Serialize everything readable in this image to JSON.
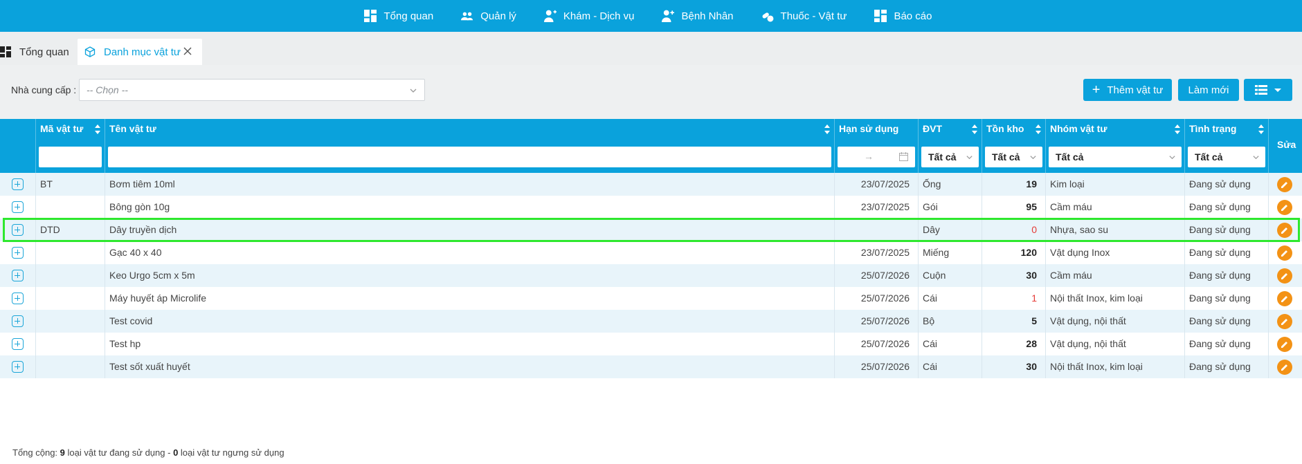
{
  "nav": {
    "items": [
      {
        "label": "Tổng quan",
        "icon": "dashboard-icon"
      },
      {
        "label": "Quản lý",
        "icon": "users-icon"
      },
      {
        "label": "Khám - Dịch vụ",
        "icon": "doctor-icon"
      },
      {
        "label": "Bệnh Nhân",
        "icon": "patient-icon"
      },
      {
        "label": "Thuốc - Vật tư",
        "icon": "pills-icon"
      },
      {
        "label": "Báo cáo",
        "icon": "report-icon"
      }
    ]
  },
  "tabs": [
    {
      "label": "Tổng quan",
      "active": false
    },
    {
      "label": "Danh mục vật tư",
      "active": true
    }
  ],
  "filter": {
    "supplier_label": "Nhà cung cấp :",
    "supplier_placeholder": "-- Chọn --",
    "add_button": "Thêm vật tư",
    "refresh_button": "Làm mới"
  },
  "table": {
    "headers": {
      "code": "Mã vật tư",
      "name": "Tên vật tư",
      "expiry": "Hạn sử dụng",
      "unit": "ĐVT",
      "stock": "Tồn kho",
      "group": "Nhóm vật tư",
      "status": "Tình trạng",
      "edit": "Sửa"
    },
    "filters": {
      "unit": "Tất cả",
      "stock": "Tất cả",
      "group": "Tất cả",
      "status": "Tất cả",
      "date_separator": "→"
    },
    "rows": [
      {
        "code": "BT",
        "name": "Bơm tiêm 10ml",
        "expiry": "23/07/2025",
        "unit": "Ống",
        "stock": "19",
        "group": "Kim loại",
        "status": "Đang sử dụng"
      },
      {
        "code": "",
        "name": "Bông gòn 10g",
        "expiry": "23/07/2025",
        "unit": "Gói",
        "stock": "95",
        "group": "Cầm máu",
        "status": "Đang sử dụng"
      },
      {
        "code": "DTD",
        "name": "Dây truyền dịch",
        "expiry": "",
        "unit": "Dây",
        "stock": "0",
        "group": "Nhựa, sao su",
        "status": "Đang sử dụng"
      },
      {
        "code": "",
        "name": "Gạc 40 x 40",
        "expiry": "23/07/2025",
        "unit": "Miếng",
        "stock": "120",
        "group": "Vật dụng Inox",
        "status": "Đang sử dụng"
      },
      {
        "code": "",
        "name": "Keo Urgo 5cm x 5m",
        "expiry": "25/07/2026",
        "unit": "Cuộn",
        "stock": "30",
        "group": "Cầm máu",
        "status": "Đang sử dụng"
      },
      {
        "code": "",
        "name": "Máy huyết áp Microlife",
        "expiry": "25/07/2026",
        "unit": "Cái",
        "stock": "1",
        "group": "Nội thất Inox, kim loại",
        "status": "Đang sử dụng"
      },
      {
        "code": "",
        "name": "Test covid",
        "expiry": "25/07/2026",
        "unit": "Bộ",
        "stock": "5",
        "group": "Vật dụng, nội thất",
        "status": "Đang sử dụng"
      },
      {
        "code": "",
        "name": "Test hp",
        "expiry": "25/07/2026",
        "unit": "Cái",
        "stock": "28",
        "group": "Vật dụng, nội thất",
        "status": "Đang sử dụng"
      },
      {
        "code": "",
        "name": "Test sốt xuất huyết",
        "expiry": "25/07/2026",
        "unit": "Cái",
        "stock": "30",
        "group": "Nội thất Inox, kim loại",
        "status": "Đang sử dụng"
      }
    ],
    "low_stock_values": [
      "0",
      "1"
    ]
  },
  "footer": {
    "prefix": "Tổng cộng: ",
    "active_count": "9",
    "active_text": " loại vật tư đang sử dụng - ",
    "inactive_count": "0",
    "inactive_text": " loại vật tư ngưng sử dụng"
  },
  "colors": {
    "primary": "#0aa2dc",
    "edit": "#f39215",
    "highlight": "#2ee82e",
    "low_stock": "#e53935"
  }
}
